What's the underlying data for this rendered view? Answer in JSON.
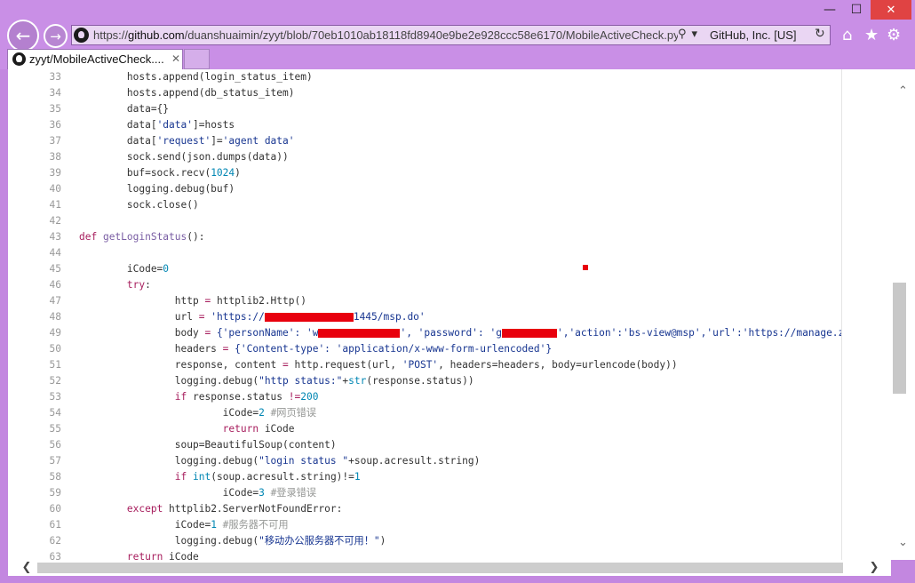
{
  "window": {
    "min_glyph": "—",
    "max_glyph": "☐",
    "close_glyph": "✕"
  },
  "nav": {
    "back_glyph": "←",
    "forward_glyph": "→"
  },
  "address": {
    "url_prefix": "https://",
    "url_domain": "github.com",
    "url_path": "/duanshuaimin/zyyt/blob/70eb1010ab18118fd8940e9be2e928ccc58e6170/MobileActiveCheck.py",
    "search_glyph": "⚲",
    "lock_glyph": "🔒",
    "dropdown_glyph": "▾",
    "ssl_label": "GitHub, Inc. [US]",
    "refresh_glyph": "↻"
  },
  "toolbar": {
    "home_glyph": "⌂",
    "favorites_glyph": "★",
    "settings_glyph": "⚙"
  },
  "tab": {
    "title": "zyyt/MobileActiveCheck....",
    "close_glyph": "✕"
  },
  "code": {
    "lines": [
      {
        "n": "33",
        "t": "        hosts.append(login_status_item)"
      },
      {
        "n": "34",
        "t": "        hosts.append(db_status_item)"
      },
      {
        "n": "35",
        "t": "        data={}"
      },
      {
        "n": "36",
        "a": "        data[",
        "b": "'data'",
        "c": "]=hosts"
      },
      {
        "n": "37",
        "a": "        data[",
        "b": "'request'",
        "c": "]=",
        "d": "'agent data'"
      },
      {
        "n": "38",
        "t": "        sock.send(json.dumps(data))"
      },
      {
        "n": "39",
        "a": "        buf=sock.recv(",
        "b": "1024",
        "c": ")"
      },
      {
        "n": "40",
        "t": "        logging.debug(buf)"
      },
      {
        "n": "41",
        "t": "        sock.close()"
      },
      {
        "n": "42",
        "t": ""
      },
      {
        "n": "43",
        "a": "def ",
        "b": "getLoginStatus",
        "c": "():"
      },
      {
        "n": "44",
        "t": ""
      },
      {
        "n": "45",
        "a": "        iCode=",
        "b": "0"
      },
      {
        "n": "46",
        "a": "        ",
        "b": "try",
        "c": ":"
      },
      {
        "n": "47",
        "a": "                http ",
        "b": "=",
        "c": " httplib2.Http()"
      },
      {
        "n": "48",
        "a": "                url ",
        "b": "=",
        "c": " 'https://",
        "d": "1445/msp.do'"
      },
      {
        "n": "49",
        "a": "                body ",
        "b": "=",
        "c": " {'personName': 'w",
        "d": "', 'password': 'g",
        "e": "','action':'bs-view@msp','url':'https://manage.zyyt"
      },
      {
        "n": "50",
        "a": "                headers ",
        "b": "=",
        "c": " {'Content-type': 'application/x-www-form-urlencoded'}"
      },
      {
        "n": "51",
        "a": "                response, content ",
        "b": "=",
        "c": " http.request(url, ",
        "d": "'POST'",
        ", e": "",
        "e": ", headers=headers, body=urlencode(body))"
      },
      {
        "n": "52",
        "a": "                logging.debug(",
        "b": "\"http status:\"",
        "c": "+",
        "d": "str",
        "e": "(response.status))"
      },
      {
        "n": "53",
        "a": "                ",
        "b": "if",
        "c": " response.status ",
        "d": "!=",
        "e": "200",
        ":": ""
      },
      {
        "n": "54",
        "a": "                        iCode=",
        "b": "2",
        "c": " #网页错误"
      },
      {
        "n": "55",
        "a": "                        ",
        "b": "return",
        "c": " iCode"
      },
      {
        "n": "56",
        "t": "                soup=BeautifulSoup(content)"
      },
      {
        "n": "57",
        "a": "                logging.debug(",
        "b": "\"login status \"",
        "c": "+soup.acresult.string)"
      },
      {
        "n": "58",
        "a": "                ",
        "b": "if",
        "c": " ",
        "d": "int",
        "e": "(soup.acresult.string)!=",
        "f": "1",
        ":": ""
      },
      {
        "n": "59",
        "a": "                        iCode=",
        "b": "3",
        "c": " #登录错误"
      },
      {
        "n": "60",
        "a": "        ",
        "b": "except",
        "c": " httplib2.ServerNotFoundError:"
      },
      {
        "n": "61",
        "a": "                iCode=",
        "b": "1",
        "c": " #服务器不可用"
      },
      {
        "n": "62",
        "a": "                logging.debug(",
        "b": "\"移动办公服务器不可用！\"",
        "c": ")"
      },
      {
        "n": "63",
        "a": "        ",
        "b": "return",
        "c": " iCode"
      }
    ]
  },
  "scroll": {
    "up_glyph": "⌃",
    "down_glyph": "⌄",
    "left_glyph": "❮",
    "right_glyph": "❯"
  }
}
